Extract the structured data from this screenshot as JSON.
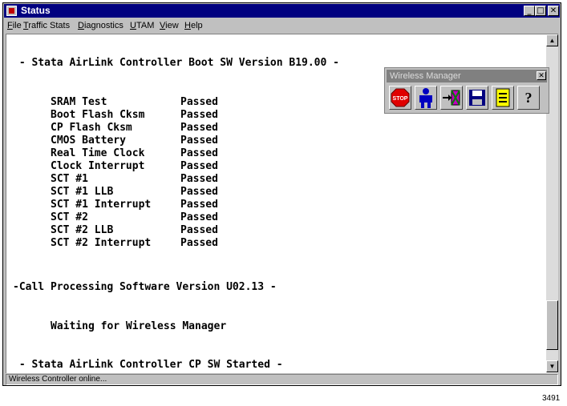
{
  "window": {
    "title": "Status"
  },
  "menu": [
    "File",
    "Traffic Stats",
    "Diagnostics",
    "UTAM",
    "View",
    "Help"
  ],
  "console": {
    "header": " - Stata AirLink Controller Boot SW Version B19.00 -",
    "tests": [
      {
        "name": "SRAM Test",
        "result": "Passed"
      },
      {
        "name": "Boot Flash Cksm",
        "result": "Passed"
      },
      {
        "name": "CP Flash Cksm",
        "result": "Passed"
      },
      {
        "name": "CMOS Battery",
        "result": "Passed"
      },
      {
        "name": "Real Time Clock",
        "result": "Passed"
      },
      {
        "name": "Clock Interrupt",
        "result": "Passed"
      },
      {
        "name": "SCT #1",
        "result": "Passed"
      },
      {
        "name": "SCT #1 LLB",
        "result": "Passed"
      },
      {
        "name": "SCT #1 Interrupt",
        "result": "Passed"
      },
      {
        "name": "SCT #2",
        "result": "Passed"
      },
      {
        "name": "SCT #2 LLB",
        "result": "Passed"
      },
      {
        "name": "SCT #2 Interrupt",
        "result": "Passed"
      }
    ],
    "cp_version": "-Call Processing Software Version U02.13 -",
    "waiting": "Waiting for Wireless Manager",
    "started": " - Stata AirLink Controller CP SW Started -"
  },
  "status_bar": "Wireless Controller online...",
  "wireless_manager": {
    "title": "Wireless Manager",
    "tools": [
      {
        "icon": "stop-icon",
        "label": "STOP"
      },
      {
        "icon": "user-icon"
      },
      {
        "icon": "login-icon"
      },
      {
        "icon": "save-icon"
      },
      {
        "icon": "notes-icon"
      },
      {
        "icon": "help-icon",
        "label": "?"
      }
    ]
  },
  "figure_number": "3491"
}
